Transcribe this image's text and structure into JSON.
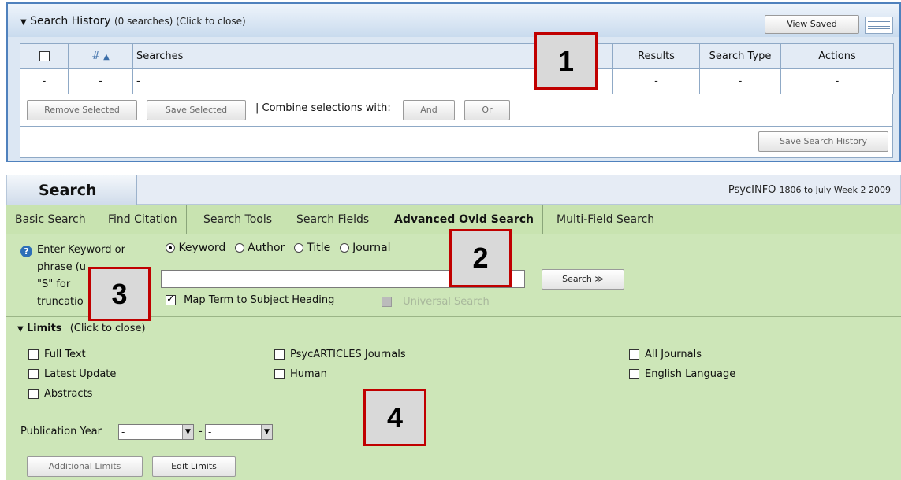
{
  "history": {
    "title": "Search History",
    "subtitle": "(0 searches) (Click to close)",
    "view_saved": "View Saved",
    "columns": [
      "#",
      "Searches",
      "Results",
      "Search Type",
      "Actions"
    ],
    "sort_glyph": "▲",
    "row": [
      "-",
      "-",
      "-",
      "-",
      "-",
      "-"
    ],
    "buttons": {
      "remove": "Remove Selected",
      "save": "Save Selected",
      "and": "And",
      "or": "Or"
    },
    "combine_label": "| Combine selections with:",
    "save_history": "Save Search History"
  },
  "search": {
    "tab_label": "Search",
    "database": "PsycINFO",
    "database_range": "1806 to July Week 2 2009",
    "tabs": [
      "Basic Search",
      "Find Citation",
      "Search Tools",
      "Search Fields",
      "Advanced Ovid Search",
      "Multi-Field Search"
    ],
    "active_tab": "Advanced Ovid Search",
    "help_glyph": "?",
    "prompt_lines": [
      "Enter Keyword or",
      "phrase (u",
      "\"S\" for",
      "truncatio"
    ],
    "radios": [
      "Keyword",
      "Author",
      "Title",
      "Journal"
    ],
    "selected_radio": "Keyword",
    "input_value": "",
    "search_button": "Search ≫",
    "map_term": "Map Term to Subject Heading",
    "map_term_checked": true,
    "universal_search": "Universal Search"
  },
  "limits": {
    "title": "Limits",
    "subtitle": "(Click to close)",
    "col1": [
      "Full Text",
      "Latest Update",
      "Abstracts"
    ],
    "col2": [
      "PsycARTICLES Journals",
      "Human"
    ],
    "col3": [
      "All Journals",
      "English Language"
    ],
    "publication_year_label": "Publication Year",
    "year_from": "-",
    "year_dash": "-",
    "year_to": "-",
    "additional_limits": "Additional Limits",
    "edit_limits": "Edit Limits"
  },
  "callouts": [
    "1",
    "2",
    "3",
    "4"
  ],
  "colors": {
    "callout_border": "#c00000",
    "panel_green": "#cde6b8",
    "panel_blue_border": "#4f81bd"
  }
}
